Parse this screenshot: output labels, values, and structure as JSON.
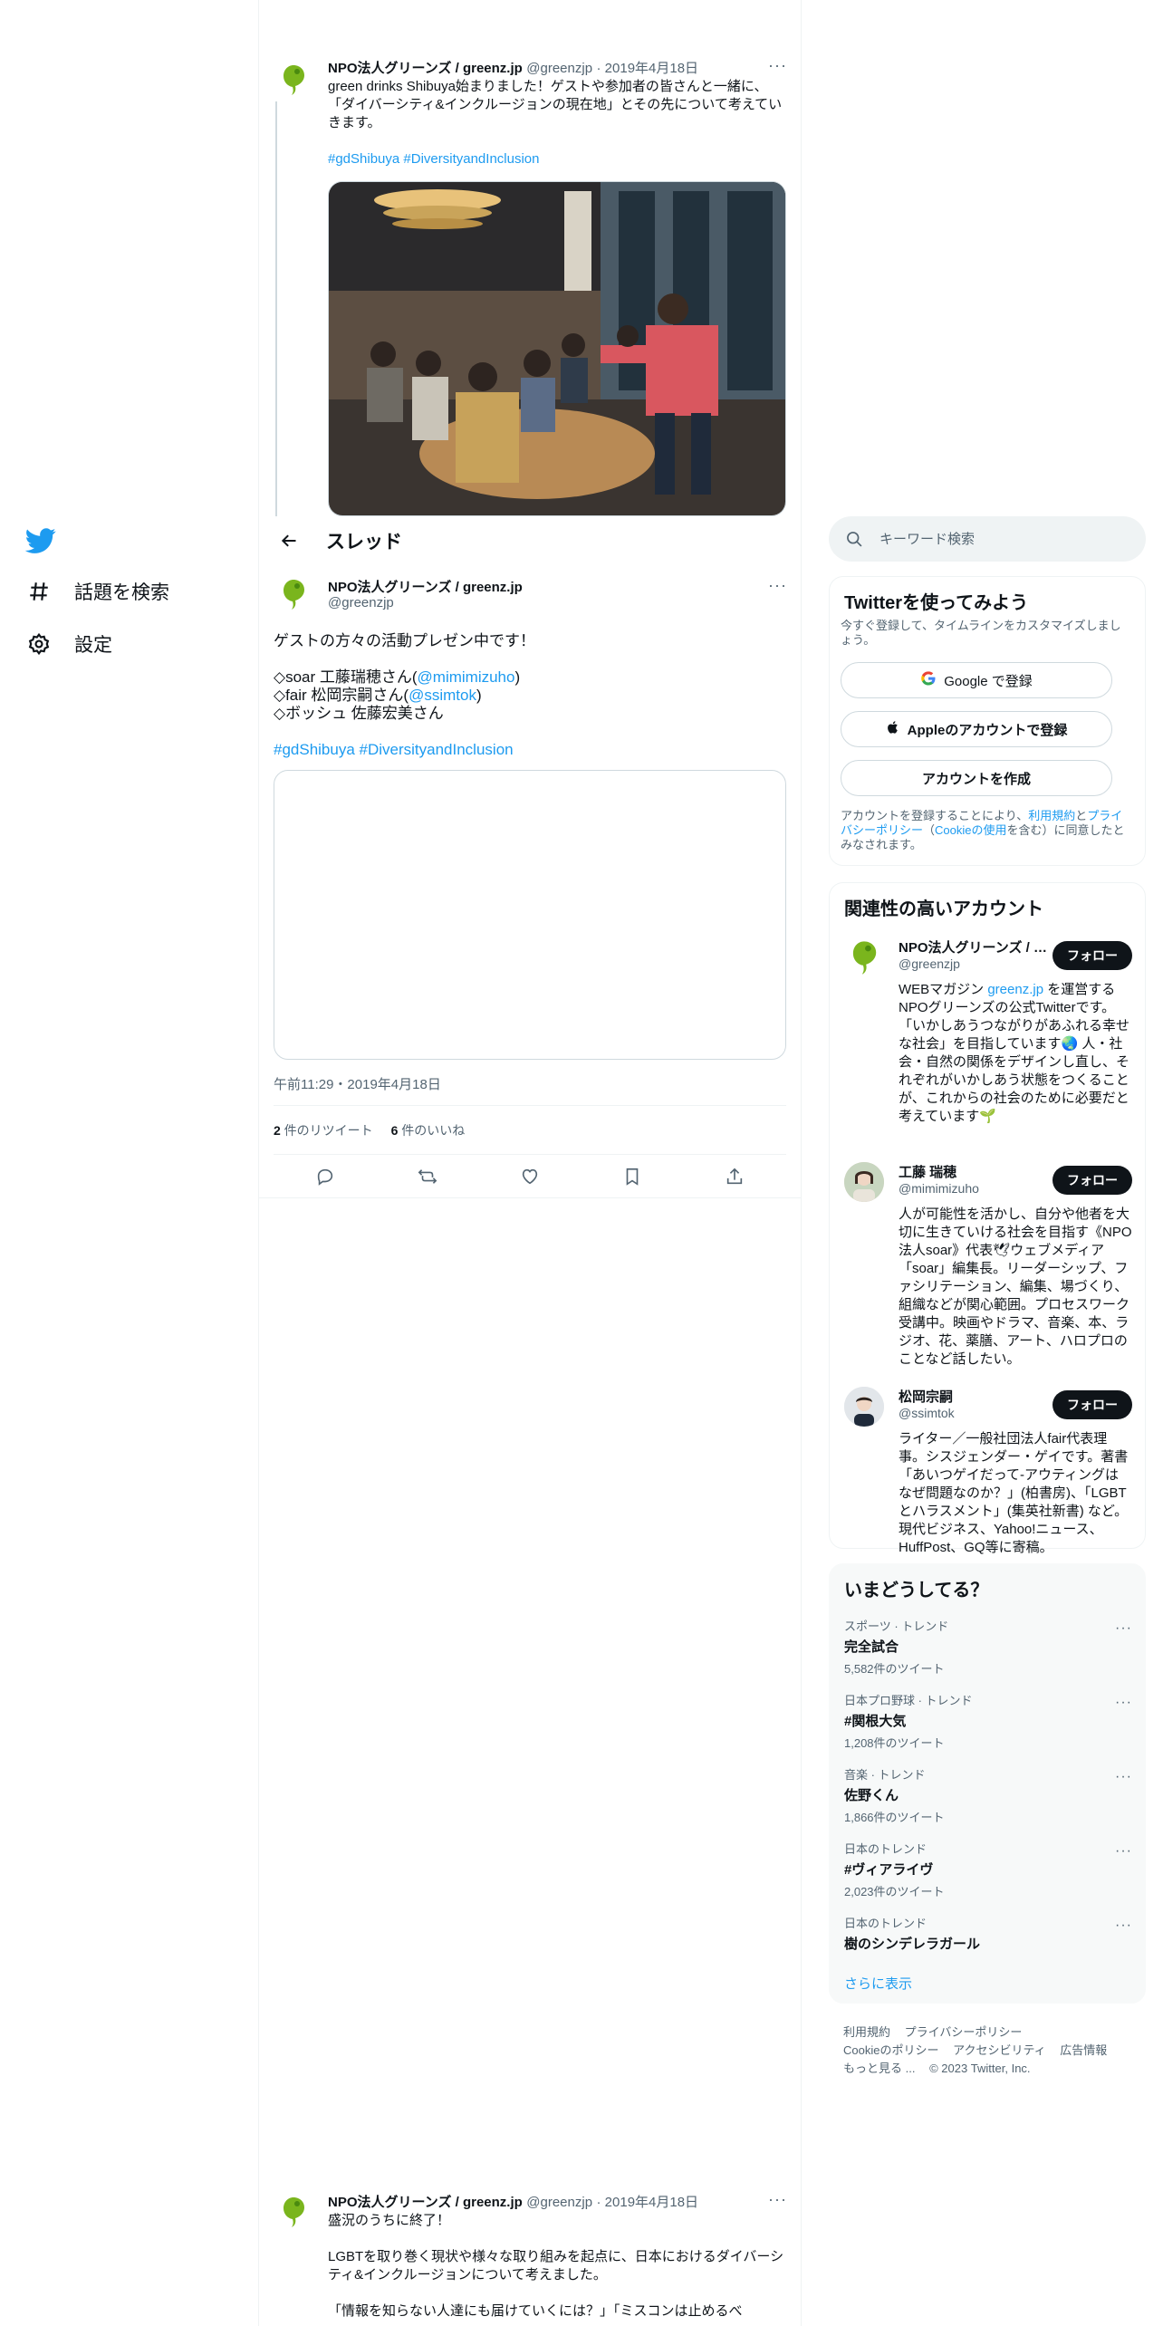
{
  "nav": {
    "items": [
      {
        "label": "話題を検索",
        "icon": "hashtag-icon"
      },
      {
        "label": "設定",
        "icon": "gear-icon"
      }
    ]
  },
  "thread": {
    "header_title": "スレッド",
    "prev_tweet": {
      "name": "NPO法人グリーンズ / greenz.jp",
      "handle": "@greenzjp",
      "date": "· 2019年4月18日",
      "text": "green drinks Shibuya始まりました！ゲストや参加者の皆さんと一緒に、「ダイバーシティ&インクルージョンの現在地」とその先について考えていきます。",
      "hashtags": "#gdShibuya #DiversityandInclusion"
    },
    "main_tweet": {
      "name": "NPO法人グリーンズ / greenz.jp",
      "handle": "@greenzjp",
      "line1": "ゲストの方々の活動プレゼン中です！",
      "line2a": "◇soar 工藤瑞穂さん(",
      "line2_mention": "@mimimizuho",
      "line2b": ")",
      "line3a": "◇fair 松岡宗嗣さん(",
      "line3_mention": "@ssimtok",
      "line3b": ")",
      "line4": "◇ボッシュ 佐藤宏美さん",
      "hashtags": "#gdShibuya #DiversityandInclusion",
      "timestamp": "午前11:29・2019年4月18日",
      "retweets_count": "2",
      "retweets_label": " 件のリツイート",
      "likes_count": "6",
      "likes_label": " 件のいいね"
    },
    "next_tweet": {
      "name": "NPO法人グリーンズ / greenz.jp",
      "handle": "@greenzjp",
      "date": "· 2019年4月18日",
      "line1": "盛況のうちに終了！",
      "line2": "LGBTを取り巻く現状や様々な取り組みを起点に、日本におけるダイバーシティ&インクルージョンについて考えました。",
      "line3": "「情報を知らない人達にも届けていくには？」「ミスコンは止めるべ"
    }
  },
  "sidebar": {
    "search_placeholder": "キーワード検索",
    "signup": {
      "title": "Twitterを使ってみよう",
      "subtitle": "今すぐ登録して、タイムラインをカスタマイズしましょう。",
      "google_btn": "Google で登録",
      "apple_btn": "Appleのアカウントで登録",
      "create_btn": "アカウントを作成",
      "legal_a": "アカウントを登録することにより、",
      "legal_terms": "利用規約",
      "legal_b": "と",
      "legal_privacy": "プライバシーポリシー",
      "legal_c": "（",
      "legal_cookie": "Cookieの使用",
      "legal_d": "を含む）に同意したとみなされます。"
    },
    "related": {
      "title": "関連性の高いアカウント",
      "follow_label": "フォロー",
      "accounts": [
        {
          "name": "NPO法人グリーンズ / greenz.jp",
          "handle": "@greenzjp",
          "bio_a": "WEBマガジン ",
          "bio_link": "greenz.jp",
          "bio_b": " を運営するNPOグリーンズの公式Twitterです。「いかしあうつながりがあふれる幸せな社会」を目指しています🌏 人・社会・自然の関係をデザインし直し、それぞれがいかしあう状態をつくることが、これからの社会のために必要だと考えています🌱"
        },
        {
          "name": "工藤 瑞穂",
          "handle": "@mimimizuho",
          "bio": "人が可能性を活かし、自分や他者を大切に生きていける社会を目指す《NPO法人soar》代表🕊ウェブメディア「soar」編集長。リーダーシップ、ファシリテーション、編集、場づくり、組織などが関心範囲。プロセスワーク受講中。映画やドラマ、音楽、本、ラジオ、花、薬膳、アート、ハロプロのことなど話したい。"
        },
        {
          "name": "松岡宗嗣",
          "handle": "@ssimtok",
          "bio": "ライター／一般社団法人fair代表理事。シスジェンダー・ゲイです。著書「あいつゲイだって-アウティングはなぜ問題なのか？」(柏書房)、「LGBTとハラスメント」(集英社新書) など。現代ビジネス、Yahoo!ニュース、HuffPost、GQ等に寄稿。"
        }
      ]
    },
    "trends": {
      "title": "いまどうしてる？",
      "items": [
        {
          "category": "スポーツ · トレンド",
          "name": "完全試合",
          "count": "5,582件のツイート"
        },
        {
          "category": "日本プロ野球 · トレンド",
          "name": "#関根大気",
          "count": "1,208件のツイート"
        },
        {
          "category": "音楽 · トレンド",
          "name": "佐野くん",
          "count": "1,866件のツイート"
        },
        {
          "category": "日本のトレンド",
          "name": "#ヴィアライヴ",
          "count": "2,023件のツイート"
        },
        {
          "category": "日本のトレンド",
          "name": "樹のシンデレラガール",
          "count": ""
        }
      ],
      "show_more": "さらに表示"
    },
    "footer": {
      "terms": "利用規約",
      "privacy": "プライバシーポリシー",
      "cookie": "Cookieのポリシー",
      "accessibility": "アクセシビリティ",
      "ads": "広告情報",
      "more": "もっと見る ...",
      "copyright": "© 2023 Twitter, Inc."
    }
  },
  "colors": {
    "accent": "#1d9bf0",
    "text": "#0f1419",
    "muted": "#536471"
  }
}
